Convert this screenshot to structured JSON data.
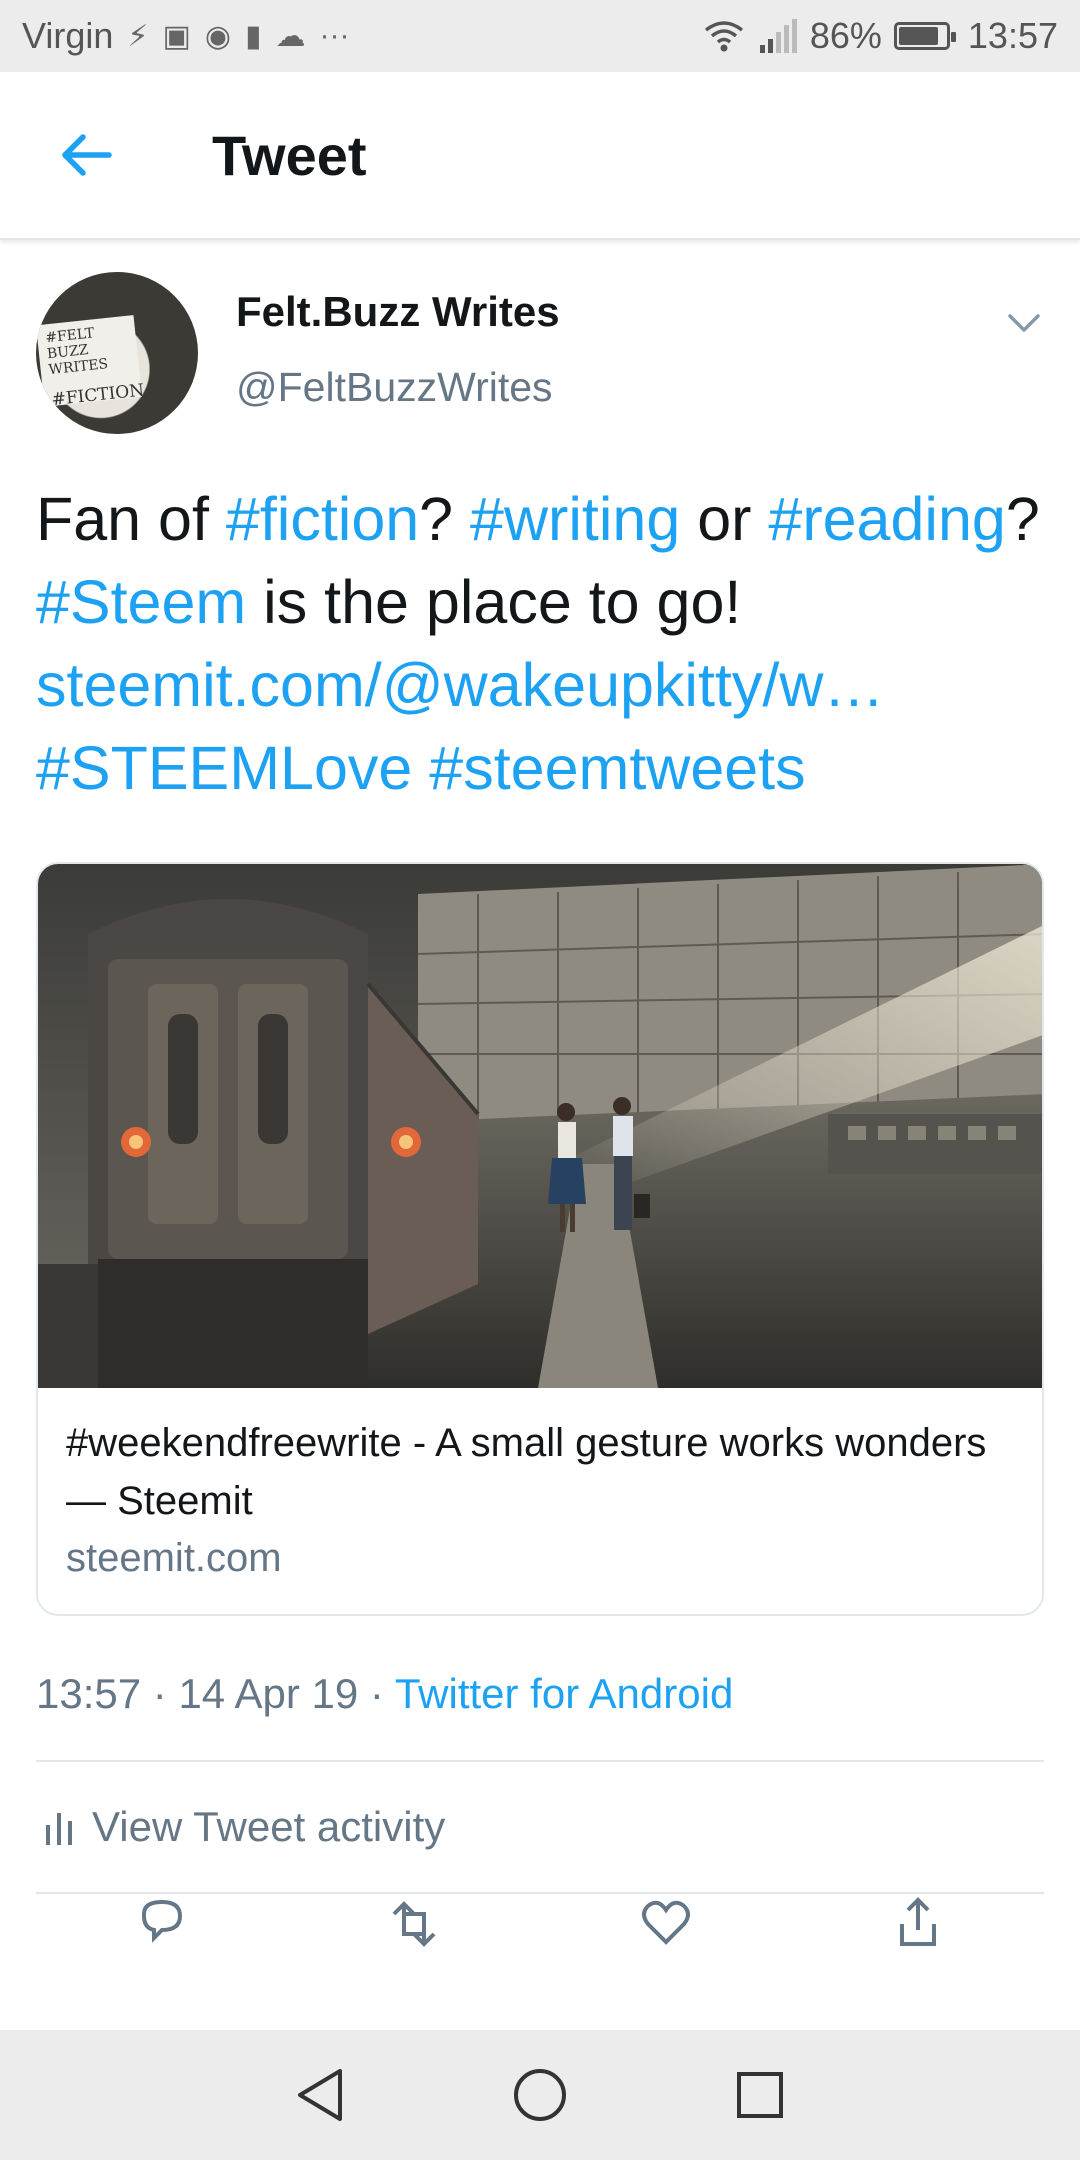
{
  "status_bar": {
    "carrier": "Virgin",
    "battery_percent": "86%",
    "battery_level": 0.86,
    "time": "13:57",
    "more": "···"
  },
  "app_bar": {
    "title": "Tweet"
  },
  "tweet": {
    "author_name": "Felt.Buzz Writes",
    "author_handle": "@FeltBuzzWrites",
    "avatar_note_lines": [
      "#FELT BUZZ",
      "WRITES",
      "#FICTION"
    ],
    "text_segments": [
      {
        "text": "Fan of ",
        "tag": false
      },
      {
        "text": "#fiction",
        "tag": true
      },
      {
        "text": "? ",
        "tag": false
      },
      {
        "text": "#writing",
        "tag": true
      },
      {
        "text": " or ",
        "tag": false
      },
      {
        "text": "#reading",
        "tag": true
      },
      {
        "text": "? ",
        "tag": false
      },
      {
        "text": "#Steem",
        "tag": true
      },
      {
        "text": " is the place to go! ",
        "tag": false
      },
      {
        "text": "steemit.com/@wakeupkitty/w…",
        "tag": true
      },
      {
        "text": " ",
        "tag": false
      },
      {
        "text": "#STEEMLove",
        "tag": true
      },
      {
        "text": " ",
        "tag": false
      },
      {
        "text": "#steemtweets",
        "tag": true
      }
    ],
    "card": {
      "title": "#weekendfreewrite - A small gesture works wonders — Steemit",
      "domain": "steemit.com"
    },
    "time": "13:57",
    "separator": " · ",
    "date": "14 Apr 19",
    "source": "Twitter for Android",
    "activity_label": "View Tweet activity"
  },
  "colors": {
    "accent": "#1da1f2",
    "text": "#14171a",
    "secondary": "#657786",
    "divider": "#e1e8ed"
  },
  "icons": {
    "back": "arrow-left-icon",
    "chevron": "chevron-down-icon",
    "activity": "bar-chart-icon",
    "actions": [
      "reply-icon",
      "retweet-icon",
      "like-icon",
      "share-icon"
    ],
    "nav": [
      "back-triangle-icon",
      "home-circle-icon",
      "recents-square-icon"
    ]
  }
}
